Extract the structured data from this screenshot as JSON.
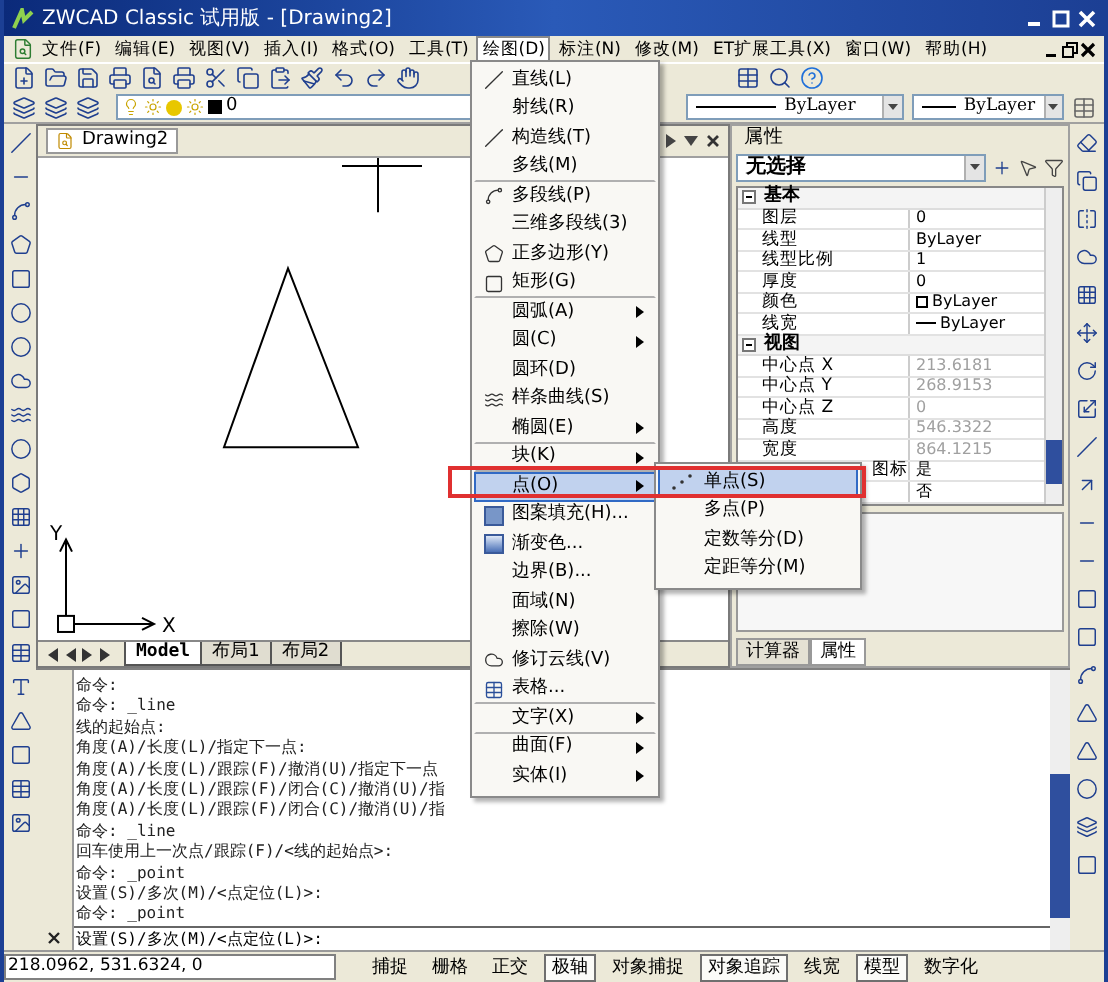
{
  "window": {
    "title": "ZWCAD Classic 试用版 - [Drawing2]"
  },
  "menu_bar": [
    {
      "label": "文件(F)",
      "selected": false
    },
    {
      "label": "编辑(E)",
      "selected": false
    },
    {
      "label": "视图(V)",
      "selected": false
    },
    {
      "label": "插入(I)",
      "selected": false
    },
    {
      "label": "格式(O)",
      "selected": false
    },
    {
      "label": "工具(T)",
      "selected": false
    },
    {
      "label": "绘图(D)",
      "selected": true
    },
    {
      "label": "标注(N)",
      "selected": false
    },
    {
      "label": "修改(M)",
      "selected": false
    },
    {
      "label": "ET扩展工具(X)",
      "selected": false
    },
    {
      "label": "窗口(W)",
      "selected": false
    },
    {
      "label": "帮助(H)",
      "selected": false
    }
  ],
  "layer_combo": {
    "value": "0"
  },
  "linetype_combo": {
    "value": "ByLayer"
  },
  "lineweight_combo": {
    "value": "ByLayer"
  },
  "drawing_window": {
    "title": "Drawing2",
    "axis_labels": [
      "Y",
      "X"
    ],
    "tabs": [
      {
        "label": "Model",
        "selected": true
      },
      {
        "label": "布局1",
        "selected": false
      },
      {
        "label": "布局2",
        "selected": false
      }
    ]
  },
  "draw_menu": {
    "items": [
      {
        "label": "直线(L)",
        "submenu": false,
        "selected": false,
        "separator_after": false
      },
      {
        "label": "射线(R)",
        "submenu": false,
        "selected": false,
        "separator_after": false
      },
      {
        "label": "构造线(T)",
        "submenu": false,
        "selected": false,
        "separator_after": false
      },
      {
        "label": "多线(M)",
        "submenu": false,
        "selected": false,
        "separator_after": true
      },
      {
        "label": "多段线(P)",
        "submenu": false,
        "selected": false,
        "separator_after": false
      },
      {
        "label": "三维多段线(3)",
        "submenu": false,
        "selected": false,
        "separator_after": false
      },
      {
        "label": "正多边形(Y)",
        "submenu": false,
        "selected": false,
        "separator_after": false
      },
      {
        "label": "矩形(G)",
        "submenu": false,
        "selected": false,
        "separator_after": true
      },
      {
        "label": "圆弧(A)",
        "submenu": true,
        "selected": false,
        "separator_after": false
      },
      {
        "label": "圆(C)",
        "submenu": true,
        "selected": false,
        "separator_after": false
      },
      {
        "label": "圆环(D)",
        "submenu": false,
        "selected": false,
        "separator_after": false
      },
      {
        "label": "样条曲线(S)",
        "submenu": false,
        "selected": false,
        "separator_after": false
      },
      {
        "label": "椭圆(E)",
        "submenu": true,
        "selected": false,
        "separator_after": true
      },
      {
        "label": "块(K)",
        "submenu": true,
        "selected": false,
        "separator_after": true
      },
      {
        "label": "点(O)",
        "submenu": true,
        "selected": true,
        "separator_after": false
      },
      {
        "label": "图案填充(H)...",
        "submenu": false,
        "selected": false,
        "separator_after": false
      },
      {
        "label": "渐变色...",
        "submenu": false,
        "selected": false,
        "separator_after": false
      },
      {
        "label": "边界(B)...",
        "submenu": false,
        "selected": false,
        "separator_after": false
      },
      {
        "label": "面域(N)",
        "submenu": false,
        "selected": false,
        "separator_after": false
      },
      {
        "label": "擦除(W)",
        "submenu": false,
        "selected": false,
        "separator_after": false
      },
      {
        "label": "修订云线(V)",
        "submenu": false,
        "selected": false,
        "separator_after": false
      },
      {
        "label": "表格...",
        "submenu": false,
        "selected": false,
        "separator_after": true
      },
      {
        "label": "文字(X)",
        "submenu": true,
        "selected": false,
        "separator_after": true
      },
      {
        "label": "曲面(F)",
        "submenu": true,
        "selected": false,
        "separator_after": false
      },
      {
        "label": "实体(I)",
        "submenu": true,
        "selected": false,
        "separator_after": false
      }
    ]
  },
  "point_submenu": {
    "items": [
      {
        "label": "单点(S)",
        "selected": true
      },
      {
        "label": "多点(P)",
        "selected": false
      },
      {
        "label": "定数等分(D)",
        "selected": false
      },
      {
        "label": "定距等分(M)",
        "selected": false
      }
    ]
  },
  "properties": {
    "title": "属性",
    "selection": "无选择",
    "groups": [
      {
        "name": "基本",
        "expanded": true,
        "rows": [
          {
            "label": "图层",
            "value": "0",
            "kind": "text",
            "readonly": false
          },
          {
            "label": "线型",
            "value": "ByLayer",
            "kind": "text",
            "readonly": false
          },
          {
            "label": "线型比例",
            "value": "1",
            "kind": "text",
            "readonly": false
          },
          {
            "label": "厚度",
            "value": "0",
            "kind": "text",
            "readonly": false
          },
          {
            "label": "颜色",
            "value": "ByLayer",
            "kind": "color",
            "readonly": false
          },
          {
            "label": "线宽",
            "value": "ByLayer",
            "kind": "lineweight",
            "readonly": false
          }
        ]
      },
      {
        "name": "视图",
        "expanded": true,
        "rows": [
          {
            "label": "中心点 X",
            "value": "213.6181",
            "kind": "text",
            "readonly": true
          },
          {
            "label": "中心点 Y",
            "value": "268.9153",
            "kind": "text",
            "readonly": true
          },
          {
            "label": "中心点 Z",
            "value": "0",
            "kind": "text",
            "readonly": true
          },
          {
            "label": "高度",
            "value": "546.3322",
            "kind": "text",
            "readonly": true
          },
          {
            "label": "宽度",
            "value": "864.1215",
            "kind": "text",
            "readonly": true
          },
          {
            "label": "图标",
            "label_clipped": true,
            "value": "是",
            "kind": "text",
            "readonly": false
          },
          {
            "value": "否",
            "kind": "text",
            "readonly": false
          }
        ]
      }
    ],
    "tabs": [
      {
        "label": "计算器",
        "selected": false
      },
      {
        "label": "属性",
        "selected": true
      }
    ]
  },
  "command_line": {
    "lines": [
      "命令:",
      "命令: _line",
      "线的起始点:",
      "角度(A)/长度(L)/指定下一点:",
      "角度(A)/长度(L)/跟踪(F)/撤消(U)/指定下一点",
      "角度(A)/长度(L)/跟踪(F)/闭合(C)/撤消(U)/指",
      "角度(A)/长度(L)/跟踪(F)/闭合(C)/撤消(U)/指",
      "命令: _line",
      "回车使用上一次点/跟踪(F)/<线的起始点>:",
      "命令: _point",
      "设置(S)/多次(M)/<点定位(L)>:",
      "命令: _point"
    ],
    "prompt": "设置(S)/多次(M)/<点定位(L)>:"
  },
  "status_bar": {
    "coordinates": "218.0962, 531.6324, 0",
    "toggles": [
      {
        "label": "捕捉",
        "on": false
      },
      {
        "label": "栅格",
        "on": false
      },
      {
        "label": "正交",
        "on": false
      },
      {
        "label": "极轴",
        "on": true
      },
      {
        "label": "对象捕捉",
        "on": false
      },
      {
        "label": "对象追踪",
        "on": true
      },
      {
        "label": "线宽",
        "on": false
      },
      {
        "label": "模型",
        "on": true
      },
      {
        "label": "数字化",
        "on": false
      }
    ]
  }
}
